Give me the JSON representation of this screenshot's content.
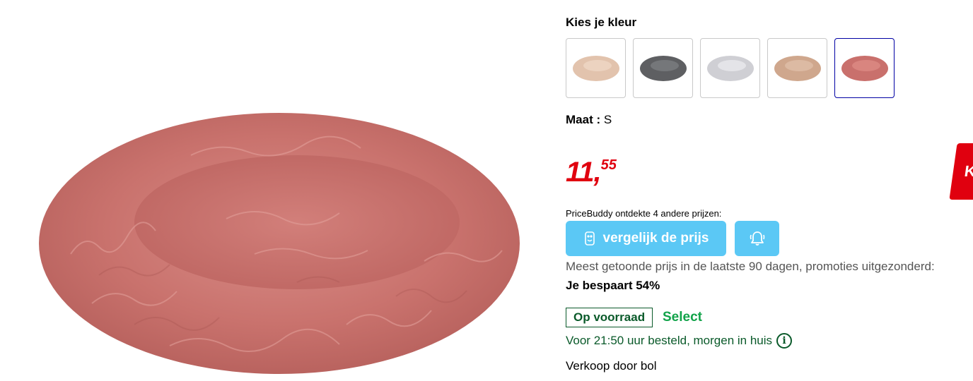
{
  "variant": {
    "title": "Kies je kleur",
    "swatches": [
      {
        "name": "beige",
        "color": "#e2c3ad"
      },
      {
        "name": "dark-grey",
        "color": "#5e5f62"
      },
      {
        "name": "light-grey",
        "color": "#cfcfd4"
      },
      {
        "name": "taupe",
        "color": "#cfa78d"
      },
      {
        "name": "pink",
        "color": "#c9706c"
      }
    ],
    "selected_index": 4
  },
  "size": {
    "label": "Maat :",
    "value": "S"
  },
  "price": {
    "integer": "11,",
    "decimals": "55",
    "color": "#e0000f"
  },
  "cta_partial_label": "K",
  "pricebuddy": {
    "text": "PriceBuddy ontdekte 4 andere prijzen:",
    "compare_label": "vergelijk de prijs",
    "accent": "#5bc8f5"
  },
  "price_history": {
    "text": "Meest getoonde prijs in de laatste 90 dagen, promoties uitgezonderd:",
    "saving": "Je bespaart 54%"
  },
  "stock": {
    "badge": "Op voorraad",
    "select": "Select",
    "delivery": "Voor 21:50 uur besteld, morgen in huis",
    "info_icon": "i"
  },
  "seller": "Verkoop door bol",
  "product_image_color": "#c9726d"
}
